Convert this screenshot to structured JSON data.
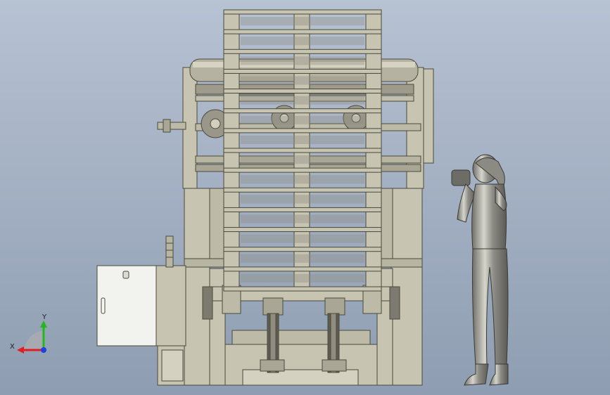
{
  "viewport": {
    "background_top": "#b7c2d3",
    "background_bottom": "#8e9db1"
  },
  "colors": {
    "frame_fill": "#c7c4b2",
    "frame_stroke": "#4a4a3a",
    "dark_steel": "#7d7b70",
    "cabinet_fill": "#f2f2ee",
    "figure_fill": "#a9a8a0",
    "axis_x": "#e02020",
    "axis_y": "#1fb81f",
    "axis_z": "#1f3fe0"
  },
  "model": {
    "pallet_rows": 14
  },
  "triad": {
    "x_label": "X",
    "y_label": "Y"
  }
}
